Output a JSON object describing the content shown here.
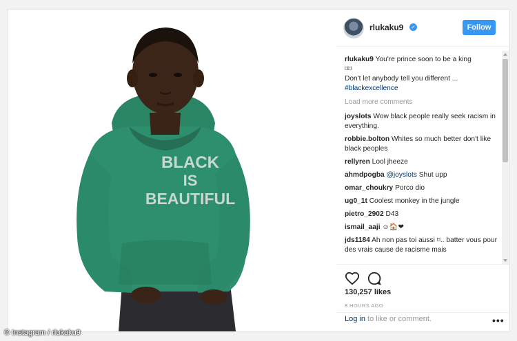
{
  "post": {
    "photo_text": [
      "BLACK",
      "IS",
      "BEAUTIFUL"
    ]
  },
  "header": {
    "username": "rlukaku9",
    "verified_icon": "✓",
    "follow_label": "Follow"
  },
  "caption": {
    "user": "rlukaku9",
    "line1": "You're prince soon to be a king",
    "emoji": "⌑⌑",
    "line2": "Don't let anybody tell you different ...",
    "hashtag": "#blackexcellence"
  },
  "load_more": "Load more comments",
  "comments": [
    {
      "user": "joyslots",
      "text": "Wow black people really seek racism in everything."
    },
    {
      "user": "robbie.bolton",
      "text": "Whites so much better don't like black peoples"
    },
    {
      "user": "rellyren",
      "text": "Lool jheeze"
    },
    {
      "user": "ahmdpogba",
      "mention": "@joyslots",
      "text": "Shut upp"
    },
    {
      "user": "omar_choukry",
      "text": "Porco dio"
    },
    {
      "user": "ug0_1t",
      "text": "Coolest monkey in the jungle"
    },
    {
      "user": "pietro_2902",
      "text": "D43"
    },
    {
      "user": "ismail_aaji",
      "text": "☺🏠❤"
    },
    {
      "user": "jds1184",
      "text": "Ah non pas toi aussi ⌑.. batter vous pour des vrais cause de racisme mais"
    }
  ],
  "likes": "130,257 likes",
  "time": "8 HOURS AGO",
  "login": {
    "link": "Log in",
    "rest": "to like or comment."
  },
  "more_label": "•••",
  "credit": "© Instagram / rlukaku9",
  "colors": {
    "accent": "#3897f0",
    "hoodie": "#2e8f6e",
    "link": "#003569"
  }
}
